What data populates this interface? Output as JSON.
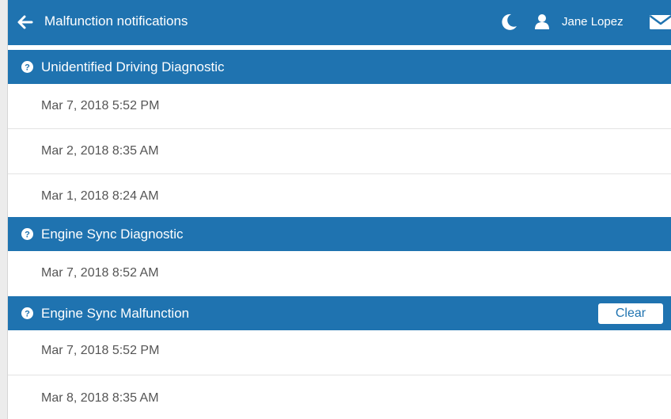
{
  "header": {
    "title": "Malfunction notifications",
    "user_name": "Jane Lopez"
  },
  "sections": [
    {
      "title": "Unidentified Driving Diagnostic",
      "entries": [
        "Mar 7, 2018 5:52 PM",
        "Mar 2, 2018 8:35 AM",
        "Mar 1, 2018 8:24 AM"
      ]
    },
    {
      "title": "Engine Sync Diagnostic",
      "entries": [
        "Mar 7, 2018 8:52 AM"
      ]
    },
    {
      "title": "Engine Sync Malfunction",
      "clear_label": "Clear",
      "entries": [
        "Mar 7, 2018 5:52 PM",
        "Mar 8, 2018 8:35 AM"
      ]
    }
  ],
  "icons": {
    "back": "arrow-left-icon",
    "night_mode": "moon-icon",
    "user": "user-icon",
    "mail": "envelope-icon",
    "help": "question-circle-icon"
  },
  "colors": {
    "brand_blue": "#1f73b0",
    "text_white": "#ffffff",
    "row_text": "#555555"
  }
}
